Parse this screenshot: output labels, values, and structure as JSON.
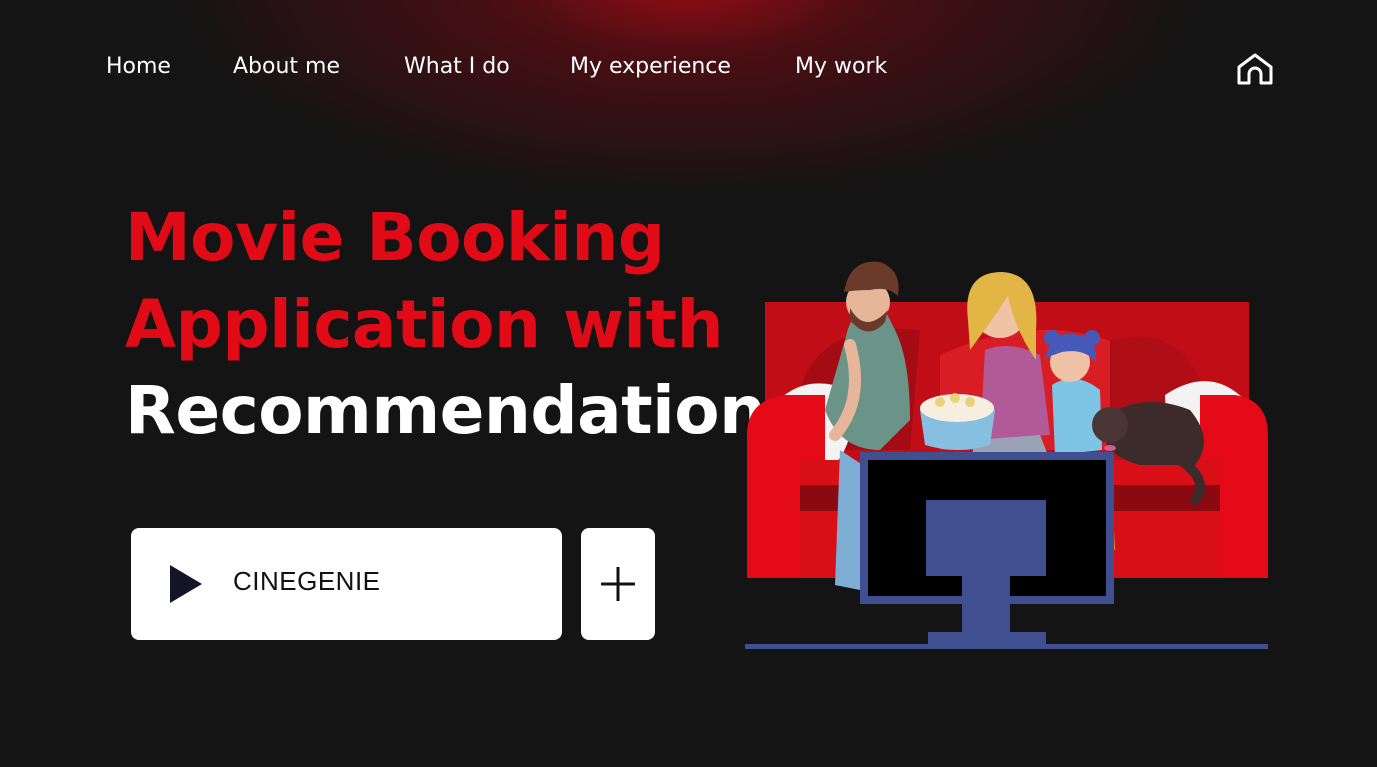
{
  "nav": {
    "items": [
      {
        "label": "Home"
      },
      {
        "label": "About me"
      },
      {
        "label": "What I do"
      },
      {
        "label": "My experience"
      },
      {
        "label": "My work"
      }
    ],
    "home_icon": "home-icon"
  },
  "hero": {
    "title_line1": "Movie Booking",
    "title_line2": "Application with",
    "title_line3": "Recommendation"
  },
  "player": {
    "play_icon": "play-icon",
    "label": "CINEGENIE",
    "add_icon": "plus-icon"
  },
  "illustration": {
    "icon": "family-watching-tv-illustration"
  },
  "colors": {
    "background": "#141414",
    "accent_red": "#e10a17",
    "sofa_red": "#d40f18",
    "tv_blue": "#3f4f8f"
  }
}
